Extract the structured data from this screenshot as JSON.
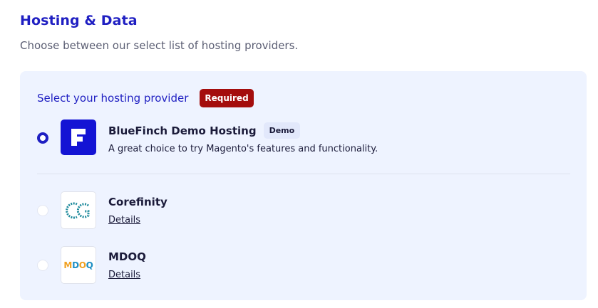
{
  "section": {
    "title": "Hosting & Data",
    "subtitle": "Choose between our select list of hosting providers."
  },
  "panel": {
    "title": "Select your hosting provider",
    "required_badge": "Required"
  },
  "options": [
    {
      "name": "BlueFinch Demo Hosting",
      "badge": "Demo",
      "description": "A great choice to try Magento's features and functionality.",
      "selected": true,
      "logo_icon": "bluefinch-logo-icon"
    },
    {
      "name": "Corefinity",
      "link": "Details",
      "selected": false,
      "logo_icon": "corefinity-logo-icon"
    },
    {
      "name": "MDOQ",
      "link": "Details",
      "selected": false,
      "logo_icon": "mdoq-logo-icon",
      "logo_text": [
        "M",
        "D",
        "O",
        "Q"
      ]
    }
  ],
  "colors": {
    "accent": "#1f1fc2",
    "required": "#a40d0d",
    "panel_bg": "#eef3ff",
    "demo_badge_bg": "#e2e8fb"
  }
}
